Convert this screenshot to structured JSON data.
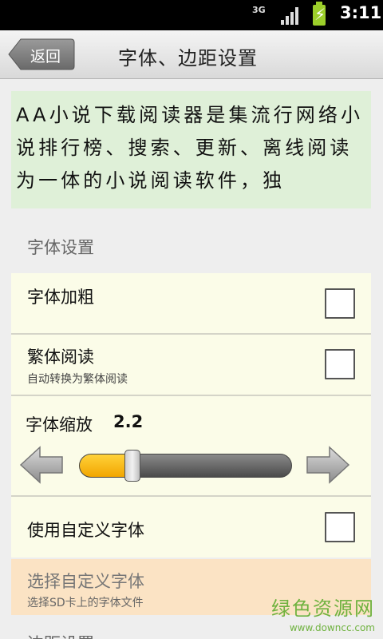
{
  "status_bar": {
    "network": "3G",
    "time": "3:11"
  },
  "header": {
    "back_label": "返回",
    "title": "字体、边距设置"
  },
  "description": "AA小说下载阅读器是集流行网络小说排行榜、搜索、更新、离线阅读为一体的小说阅读软件，独",
  "font_section": {
    "header": "字体设置",
    "bold": {
      "title": "字体加粗",
      "checked": false
    },
    "traditional": {
      "title": "繁体阅读",
      "subtitle": "自动转换为繁体阅读",
      "checked": false
    },
    "scale": {
      "label": "字体缩放",
      "value": "2.2",
      "fraction": 0.25
    },
    "custom_font": {
      "title": "使用自定义字体",
      "checked": false
    },
    "choose_font": {
      "title": "选择自定义字体",
      "subtitle": "选择SD卡上的字体文件"
    }
  },
  "next_section_header": "边距设置",
  "watermark": {
    "name": "绿色资源网",
    "url": "www.downcc.com"
  },
  "colors": {
    "accent": "#f2a600",
    "description_bg": "#dff0d8",
    "card_bg": "#fbfce8",
    "highlight_bg": "#fbe3c4"
  }
}
